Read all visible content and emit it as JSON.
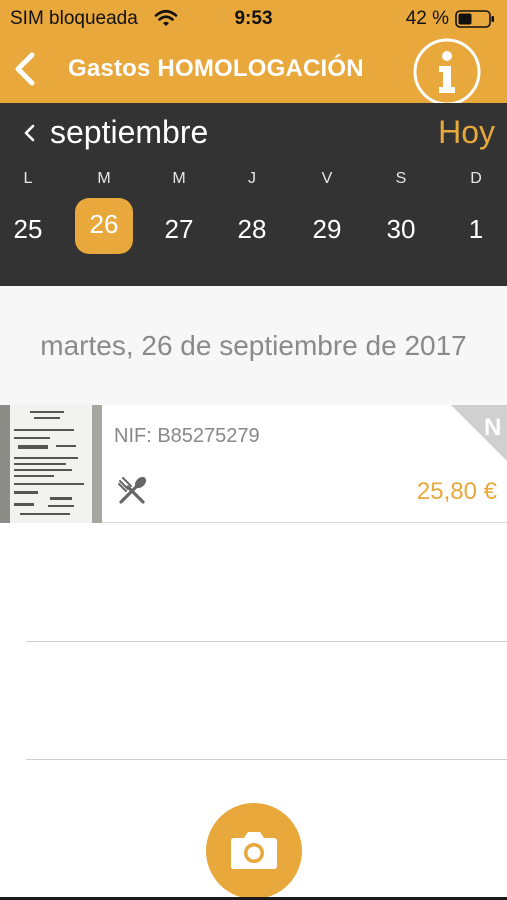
{
  "status_bar": {
    "carrier": "SIM bloqueada",
    "time": "9:53",
    "battery": "42 %"
  },
  "nav": {
    "title": "Gastos HOMOLOGACIÓN",
    "back_icon": "chevron-left-icon",
    "info_icon": "info-icon"
  },
  "calendar": {
    "month": "septiembre",
    "today_label": "Hoy",
    "weekdays": [
      "L",
      "M",
      "M",
      "J",
      "V",
      "S",
      "D"
    ],
    "days": [
      "25",
      "26",
      "27",
      "28",
      "29",
      "30",
      "1"
    ],
    "selected_index": 1
  },
  "date_header": "martes, 26 de septiembre de 2017",
  "expense": {
    "nif": "NIF: B85275279",
    "amount": "25,80 €",
    "category_icon": "cutlery-icon",
    "badge": "N"
  },
  "colors": {
    "accent": "#e8a83c",
    "dark": "#333333"
  }
}
